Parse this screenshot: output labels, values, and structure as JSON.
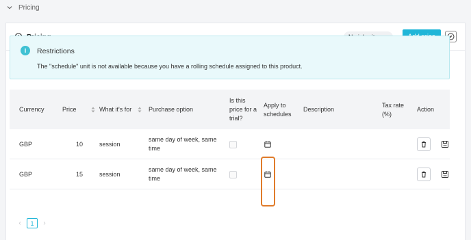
{
  "accordion": {
    "title": "Pricing"
  },
  "panel": {
    "title": "Pricing",
    "inheritance_badge": "No inheritance",
    "add_price_label": "Add price"
  },
  "restrictions": {
    "title": "Restrictions",
    "message": "The \"schedule\" unit is not available because you have a rolling schedule assigned to this product."
  },
  "table": {
    "headers": {
      "currency": "Currency",
      "price": "Price",
      "what_for": "What it's for",
      "purchase_option": "Purchase option",
      "trial_line1": "Is this",
      "trial_line2": "price for a",
      "trial_line3": "trial?",
      "apply_line1": "Apply to",
      "apply_line2": "schedules",
      "description": "Description",
      "tax_line1": "Tax rate",
      "tax_line2": "(%)",
      "action": "Action"
    },
    "rows": [
      {
        "currency": "GBP",
        "price": "10",
        "what_for": "session",
        "purchase_line1": "same day of week, same",
        "purchase_line2": "time",
        "trial": false
      },
      {
        "currency": "GBP",
        "price": "15",
        "what_for": "session",
        "purchase_line1": "same day of week, same",
        "purchase_line2": "time",
        "trial": false
      }
    ]
  },
  "pagination": {
    "current_page": "1"
  },
  "colors": {
    "accent": "#20b6d8",
    "notice_bg": "#e9f9fb",
    "highlight": "#e07b2a"
  },
  "icons": [
    "chevron-down-icon",
    "info-circle-icon",
    "compass-icon",
    "info-icon",
    "sort-icon",
    "calendar-icon",
    "trash-icon",
    "save-icon",
    "chevron-left-icon",
    "chevron-right-icon"
  ]
}
